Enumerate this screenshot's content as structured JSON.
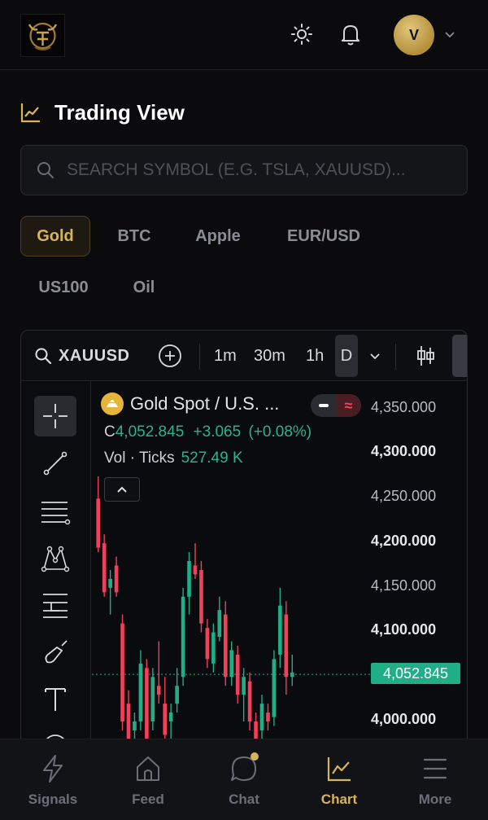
{
  "header": {
    "avatar_initial": "V"
  },
  "page": {
    "title": "Trading View"
  },
  "search": {
    "placeholder": "SEARCH SYMBOL (E.G. TSLA, XAUUSD)...",
    "value": ""
  },
  "symbols": [
    {
      "label": "Gold",
      "active": true
    },
    {
      "label": "BTC",
      "active": false
    },
    {
      "label": "Apple",
      "active": false
    },
    {
      "label": "EUR/USD",
      "active": false
    },
    {
      "label": "US100",
      "active": false
    },
    {
      "label": "Oil",
      "active": false
    }
  ],
  "chart_toolbar": {
    "symbol": "XAUUSD",
    "intervals": [
      "1m",
      "30m",
      "1h",
      "D"
    ]
  },
  "chart_legend": {
    "name": "Gold Spot / U.S. ...",
    "prefix": "C",
    "close": "4,052.845",
    "change": "+3.065",
    "change_pct": "(+0.08%)",
    "vol_label": "Vol · Ticks",
    "vol_value": "527.49 K"
  },
  "chart_data": {
    "type": "candlestick",
    "title": "Gold Spot / U.S. ...",
    "y_ticks": [
      "4,350.000",
      "4,300.000",
      "4,250.000",
      "4,200.000",
      "4,150.000",
      "4,100.000",
      "4,000.000"
    ],
    "current_price": "4,052.845",
    "ylim": [
      3980,
      4360
    ],
    "candles": [
      {
        "o": 4250,
        "h": 4275,
        "l": 4190,
        "c": 4195
      },
      {
        "o": 4200,
        "h": 4210,
        "l": 4140,
        "c": 4145
      },
      {
        "o": 4150,
        "h": 4170,
        "l": 4120,
        "c": 4160
      },
      {
        "o": 4175,
        "h": 4185,
        "l": 4140,
        "c": 4145
      },
      {
        "o": 4110,
        "h": 4120,
        "l": 3990,
        "c": 4000
      },
      {
        "o": 4020,
        "h": 4035,
        "l": 3960,
        "c": 3975
      },
      {
        "o": 3990,
        "h": 4010,
        "l": 3960,
        "c": 4000
      },
      {
        "o": 4000,
        "h": 4080,
        "l": 3990,
        "c": 4065
      },
      {
        "o": 4060,
        "h": 4070,
        "l": 3975,
        "c": 3980
      },
      {
        "o": 4000,
        "h": 4060,
        "l": 3990,
        "c": 4050
      },
      {
        "o": 4040,
        "h": 4090,
        "l": 4020,
        "c": 4030
      },
      {
        "o": 4020,
        "h": 4050,
        "l": 3970,
        "c": 3985
      },
      {
        "o": 4000,
        "h": 4020,
        "l": 3980,
        "c": 4010
      },
      {
        "o": 4020,
        "h": 4060,
        "l": 4010,
        "c": 4040
      },
      {
        "o": 4050,
        "h": 4150,
        "l": 4040,
        "c": 4140
      },
      {
        "o": 4140,
        "h": 4190,
        "l": 4120,
        "c": 4180
      },
      {
        "o": 4175,
        "h": 4200,
        "l": 4160,
        "c": 4165
      },
      {
        "o": 4170,
        "h": 4180,
        "l": 4100,
        "c": 4110
      },
      {
        "o": 4105,
        "h": 4115,
        "l": 4060,
        "c": 4070
      },
      {
        "o": 4065,
        "h": 4110,
        "l": 4055,
        "c": 4100
      },
      {
        "o": 4095,
        "h": 4140,
        "l": 4090,
        "c": 4125
      },
      {
        "o": 4120,
        "h": 4135,
        "l": 4040,
        "c": 4050
      },
      {
        "o": 4050,
        "h": 4090,
        "l": 4040,
        "c": 4080
      },
      {
        "o": 4075,
        "h": 4085,
        "l": 4020,
        "c": 4030
      },
      {
        "o": 4030,
        "h": 4060,
        "l": 4000,
        "c": 4050
      },
      {
        "o": 4045,
        "h": 4055,
        "l": 3990,
        "c": 4000
      },
      {
        "o": 4000,
        "h": 4010,
        "l": 3970,
        "c": 3975
      },
      {
        "o": 3990,
        "h": 4030,
        "l": 3980,
        "c": 4020
      },
      {
        "o": 4010,
        "h": 4020,
        "l": 3990,
        "c": 4000
      },
      {
        "o": 4005,
        "h": 4080,
        "l": 3995,
        "c": 4070
      },
      {
        "o": 4075,
        "h": 4150,
        "l": 4060,
        "c": 4130
      },
      {
        "o": 4120,
        "h": 4135,
        "l": 4030,
        "c": 4050
      },
      {
        "o": 4050,
        "h": 4075,
        "l": 4040,
        "c": 4055
      }
    ]
  },
  "bottom_nav": [
    {
      "label": "Signals",
      "icon": "bolt-icon",
      "active": false
    },
    {
      "label": "Feed",
      "icon": "home-icon",
      "active": false
    },
    {
      "label": "Chat",
      "icon": "chat-icon",
      "active": false,
      "dot": true
    },
    {
      "label": "Chart",
      "icon": "chart-icon",
      "active": true
    },
    {
      "label": "More",
      "icon": "menu-icon",
      "active": false
    }
  ],
  "colors": {
    "accent": "#d8b45a",
    "up": "#1fae86",
    "down": "#f0405a",
    "background": "#0b0b0d"
  }
}
